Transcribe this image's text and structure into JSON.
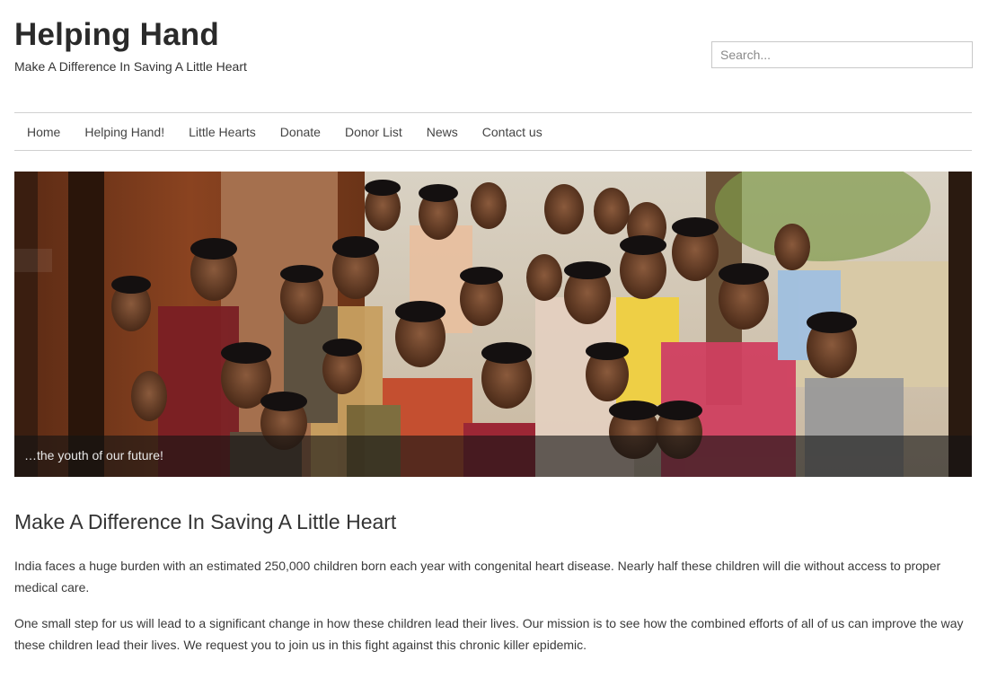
{
  "site": {
    "title": "Helping Hand",
    "tagline": "Make A Difference In Saving A Little Heart"
  },
  "search": {
    "placeholder": "Search..."
  },
  "nav": {
    "items": [
      {
        "label": "Home"
      },
      {
        "label": "Helping Hand!"
      },
      {
        "label": "Little Hearts"
      },
      {
        "label": "Donate"
      },
      {
        "label": "Donor List"
      },
      {
        "label": "News"
      },
      {
        "label": "Contact us"
      }
    ]
  },
  "hero": {
    "caption": "…the youth of our future!"
  },
  "content": {
    "heading": "Make A Difference In Saving A Little Heart",
    "paragraphs": [
      "India faces a huge burden with an estimated 250,000 children born each year with congenital heart disease. Nearly half these children will die without access to proper medical care.",
      "One small step for us will lead to a significant change in how these children lead their lives. Our mission is to see how the combined efforts of all of us can improve the way these children lead their lives. We request you to join us in this fight against this chronic killer epidemic."
    ]
  },
  "colors": {
    "text": "#333333",
    "border": "#d0d0d0",
    "caption_bar": "#141414"
  }
}
